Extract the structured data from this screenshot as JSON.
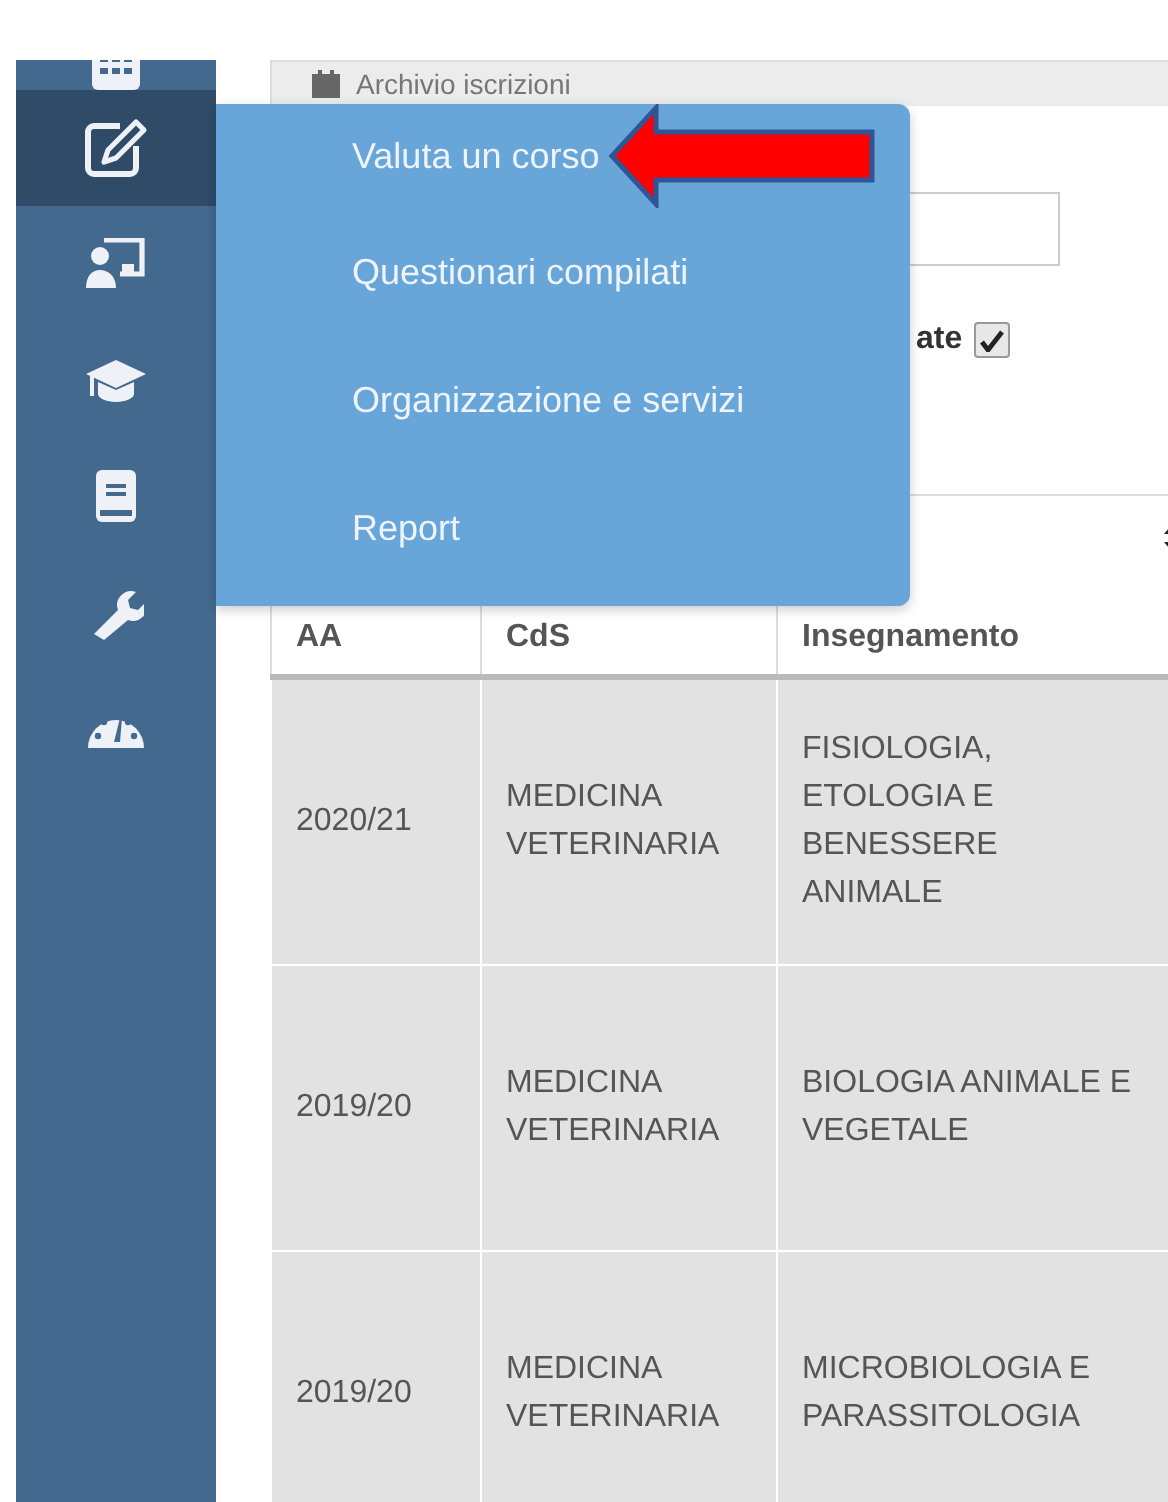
{
  "sidebar": {
    "items": [
      {
        "selected": false
      },
      {
        "selected": true
      },
      {
        "selected": false
      },
      {
        "selected": false
      },
      {
        "selected": false
      },
      {
        "selected": false
      },
      {
        "selected": false
      }
    ]
  },
  "panel": {
    "title": "Archivio iscrizioni",
    "filter": {
      "label": "ate",
      "checked": true
    }
  },
  "table": {
    "columns": [
      {
        "label": "AA",
        "sortable": false
      },
      {
        "label": "CdS",
        "sortable": false
      },
      {
        "label": "Insegnamento",
        "sortable": true
      }
    ],
    "rows": [
      [
        "2020/21",
        "MEDICINA VETERINARIA",
        "FISIOLOGIA, ETOLOGIA E BENESSERE ANIMALE"
      ],
      [
        "2019/20",
        "MEDICINA VETERINARIA",
        "BIOLOGIA ANIMALE E VEGETALE"
      ],
      [
        "2019/20",
        "MEDICINA VETERINARIA",
        "MICROBIOLOGIA E PARASSITOLOGIA"
      ]
    ]
  },
  "menu": {
    "items": [
      {
        "label": "Valuta un corso",
        "arrow": true
      },
      {
        "label": "Questionari compilati",
        "arrow": false
      },
      {
        "label": "Organizzazione e servizi",
        "arrow": false
      },
      {
        "label": "Report",
        "arrow": false
      }
    ]
  }
}
